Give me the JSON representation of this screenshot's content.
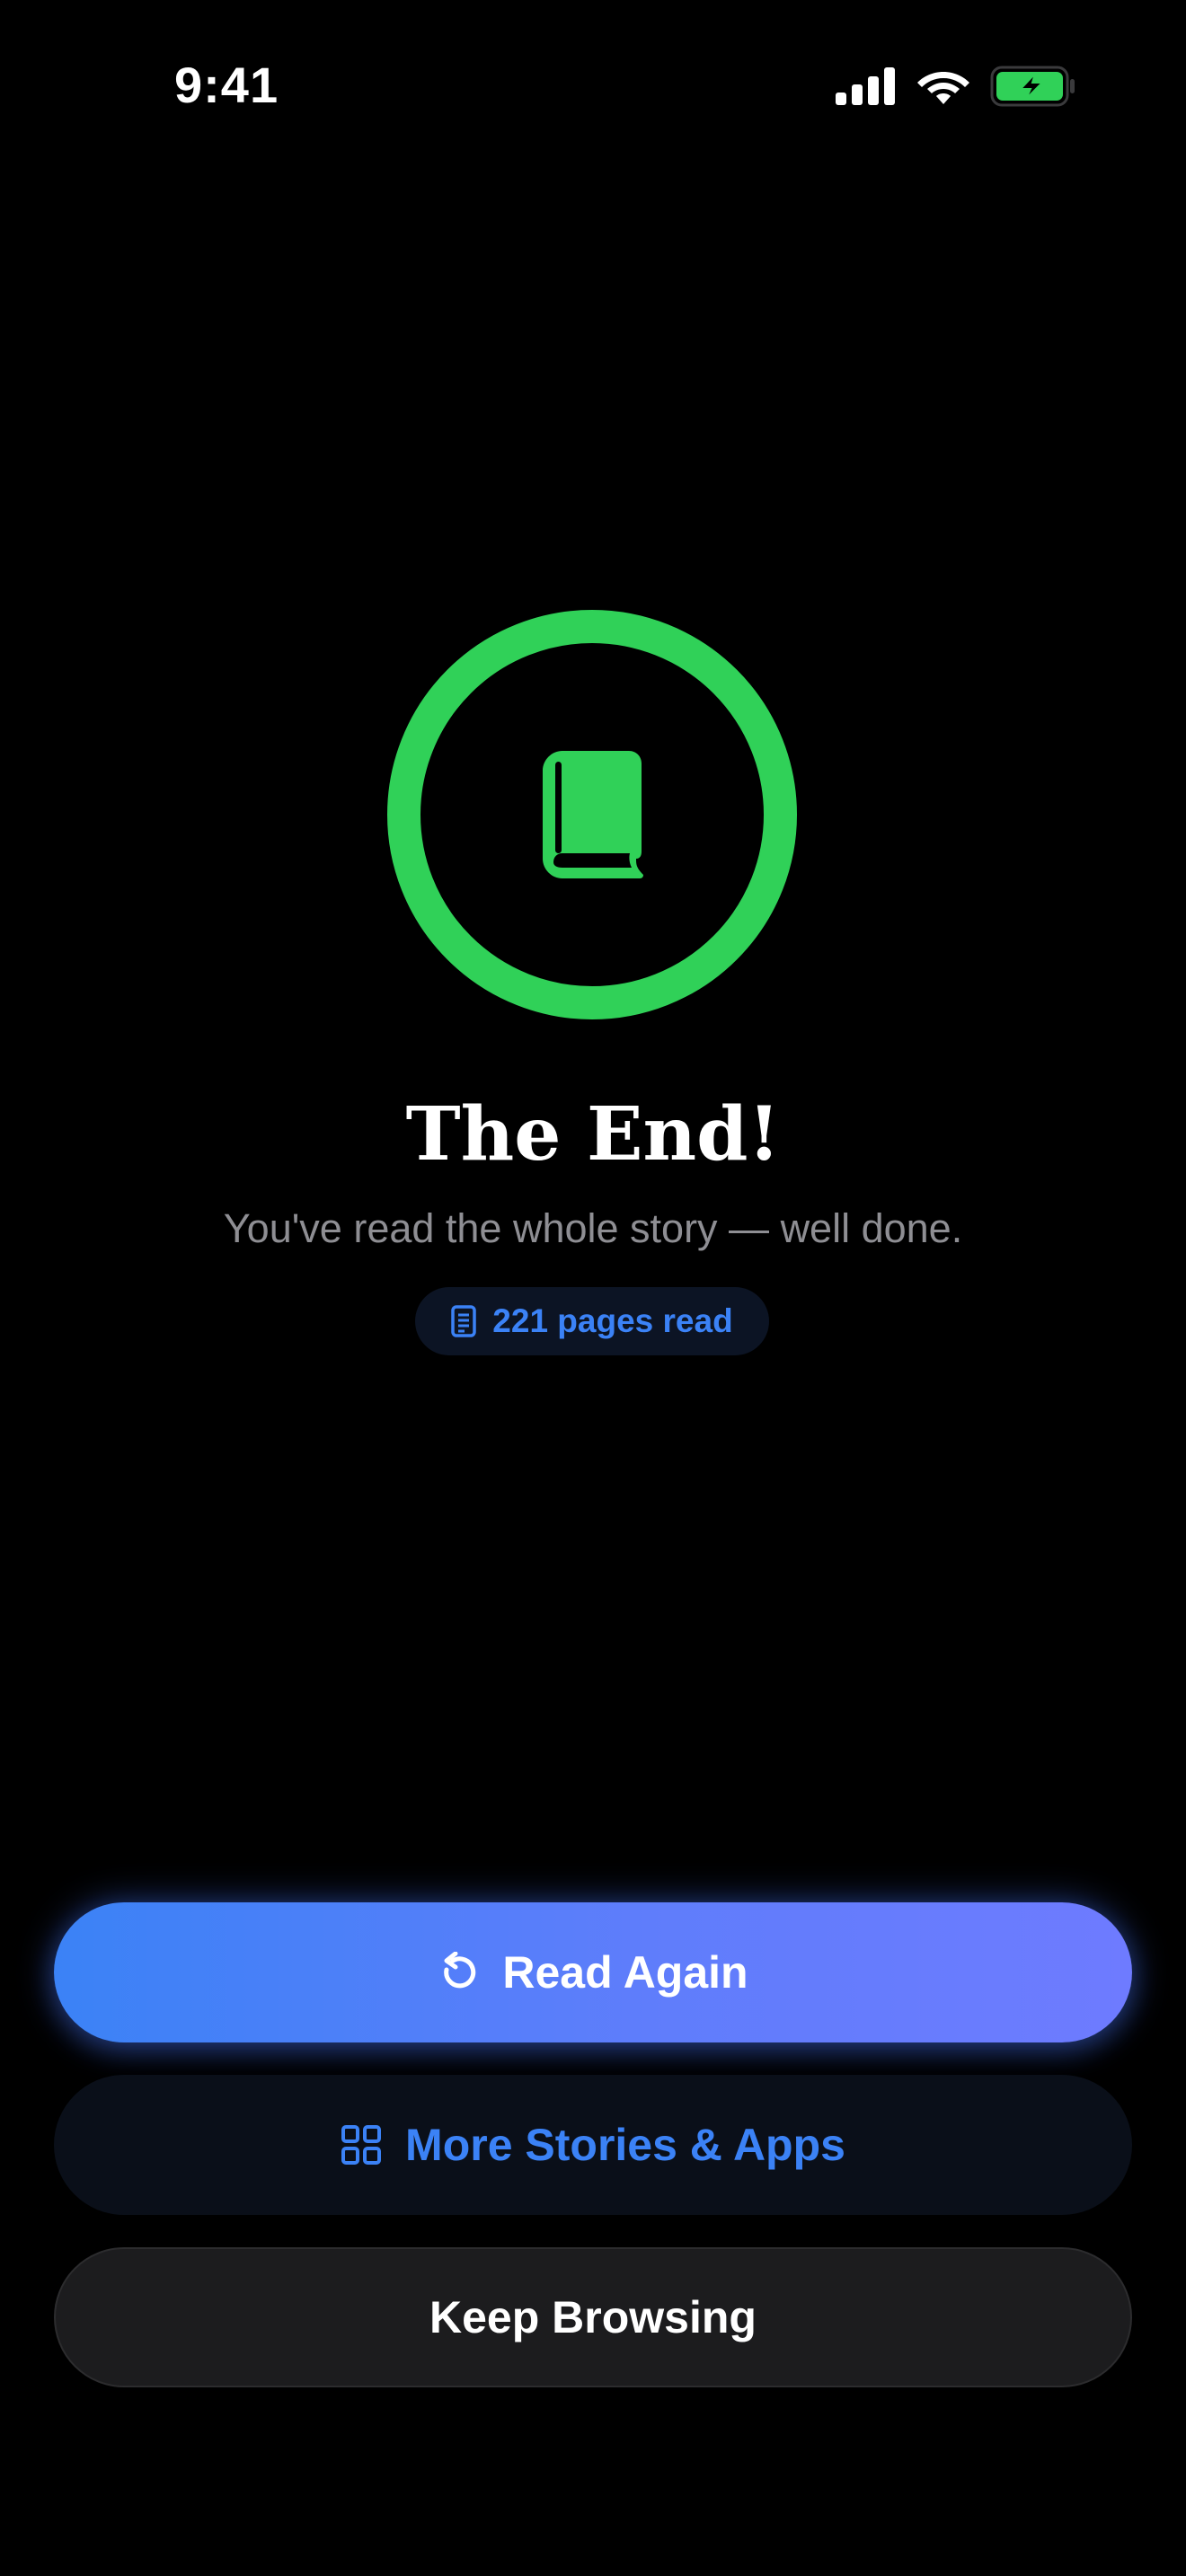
{
  "status_bar": {
    "time": "9:41",
    "icons": [
      "cellular-signal-icon",
      "wifi-icon",
      "battery-charging-icon"
    ],
    "battery_color": "#30d158"
  },
  "completion": {
    "icon": "book-icon",
    "ring_color": "#30d158",
    "title": "The End!",
    "subtitle": "You've read the whole story — well done.",
    "pages_chip": {
      "icon": "document-icon",
      "label": "221 pages read"
    }
  },
  "actions": {
    "read_again": {
      "label": "Read Again",
      "icon": "replay-icon"
    },
    "more_stories": {
      "label": "More Stories & Apps",
      "icon": "grid-icon"
    },
    "keep_browsing": {
      "label": "Keep Browsing"
    }
  },
  "colors": {
    "accent_blue": "#3b82f6",
    "gradient_end": "#6e7bff",
    "success_green": "#30d158",
    "muted_text": "#8e8e93"
  }
}
